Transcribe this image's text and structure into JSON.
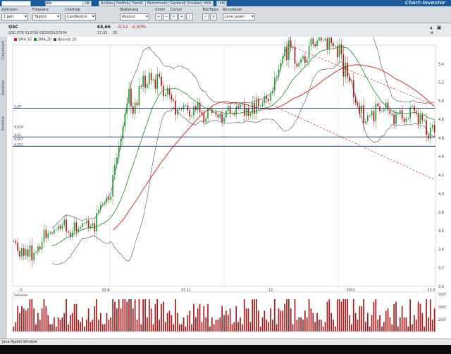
{
  "topbar": {
    "search_value": "",
    "symbol_value": "Alle",
    "search_button": "OK",
    "buttons": [
      "Auflösung",
      "Portfolio",
      "Trendf.",
      "Benchmark",
      "Gleitende",
      "Drucken",
      "Hilfe",
      "Info"
    ],
    "brand": "Chart-Investor"
  },
  "controls": {
    "groups": [
      {
        "label": "Zeitraum",
        "value": "1 Jahr"
      },
      {
        "label": "Frequenz",
        "value": "Täglich"
      },
      {
        "label": "Charttyp",
        "value": "Candlestick"
      },
      {
        "label": "Skalierung",
        "value": "Absolut"
      }
    ],
    "zoom_label": "Zoom",
    "cursor_label": "Cursor",
    "tooltips_label": "ToolTipps",
    "annotation_label": "Annotation",
    "annotation_value": "Linie Lesen"
  },
  "info": {
    "symbol": "QSC",
    "price": "€4,66",
    "change": "-0,12",
    "change_pct": "-2,50%",
    "exchange_line": "QSC ETR   513700   DE0005137004",
    "time": "17:35",
    "volume": "35"
  },
  "side_tabs": [
    "Chartbuch",
    "Kursliste",
    "Portfolio"
  ],
  "statusbar": "Java Applet Window",
  "colors": {
    "up": "#2e9e3a",
    "down": "#a81e1e",
    "sma50": "#d02020",
    "sma20": "#1c8a2a",
    "bollinger": "#505050",
    "trendline": "#c04040",
    "support": "#1a3a6a"
  },
  "chart_data": {
    "type": "candlestick",
    "legend": [
      "SMA 50",
      "SMA 20",
      "Bbands 20"
    ],
    "legend_placement": "top-left",
    "x_tick_labels": [
      "O",
      "12.8",
      "17.11",
      "12",
      "2011",
      "12.3"
    ],
    "y_tick_labels": [
      "5,4",
      "5,2",
      "5,0",
      "4,8",
      "4,6",
      "4,4",
      "4,2",
      "4,0",
      "3,8",
      "3,6",
      "3,4",
      "3,2",
      "3,0"
    ],
    "ylim": [
      3.0,
      5.6
    ],
    "left_price_labels": [
      "5,20",
      "4,929",
      "4,61",
      "4,567",
      "4,511"
    ],
    "horizontal_lines": [
      4.92,
      4.61,
      4.51
    ],
    "series": [
      {
        "name": "Close",
        "values": [
          3.49,
          3.47,
          3.38,
          3.32,
          3.41,
          3.33,
          3.4,
          3.32,
          3.44,
          3.28,
          3.36,
          3.37,
          3.43,
          3.4,
          3.48,
          3.61,
          3.52,
          3.57,
          3.58,
          3.57,
          3.61,
          3.61,
          3.65,
          3.62,
          3.66,
          3.72,
          3.59,
          3.58,
          3.53,
          3.59,
          3.69,
          3.59,
          3.62,
          3.64,
          3.68,
          3.68,
          3.71,
          3.63,
          3.65,
          3.68,
          3.59,
          3.79,
          3.82,
          3.88,
          3.89,
          3.9,
          3.96,
          3.93,
          3.97,
          4.2,
          4.31,
          4.39,
          4.51,
          4.59,
          4.72,
          4.86,
          4.97,
          5.13,
          4.94,
          4.86,
          4.98,
          4.95,
          5.16,
          5.15,
          5.27,
          5.14,
          5.18,
          5.3,
          5.22,
          5.23,
          5.13,
          5.29,
          5.26,
          5.16,
          5.05,
          5.07,
          5.13,
          5.06,
          5.01,
          5.0,
          4.85,
          4.91,
          4.92,
          4.91,
          4.95,
          4.95,
          4.9,
          4.83,
          4.84,
          4.94,
          4.9,
          4.98,
          4.88,
          4.86,
          4.77,
          4.81,
          4.91,
          4.91,
          4.87,
          4.88,
          4.85,
          4.82,
          4.86,
          4.77,
          4.82,
          4.89,
          4.94,
          4.86,
          4.87,
          4.85,
          4.94,
          4.92,
          4.96,
          4.97,
          4.84,
          4.92,
          4.84,
          4.86,
          4.98,
          4.86,
          5.01,
          4.94,
          4.94,
          4.98,
          5.05,
          5.02,
          5.0,
          5.08,
          5.11,
          5.25,
          5.26,
          5.34,
          5.41,
          5.48,
          5.58,
          5.44,
          5.65,
          5.57,
          5.58,
          5.4,
          5.37,
          5.41,
          5.45,
          5.48,
          5.41,
          5.45,
          5.59,
          5.67,
          5.61,
          5.59,
          5.65,
          5.68,
          5.65,
          5.65,
          5.67,
          5.56,
          5.68,
          5.62,
          5.59,
          5.59,
          5.47,
          5.61,
          5.5,
          5.26,
          5.41,
          5.26,
          5.21,
          5.22,
          5.04,
          4.98,
          4.95,
          4.86,
          4.95,
          4.76,
          4.78,
          4.84,
          4.84,
          4.89,
          4.78,
          4.97,
          4.94,
          4.89,
          4.89,
          4.91,
          4.98,
          4.9,
          4.86,
          4.85,
          4.75,
          4.86,
          4.86,
          4.9,
          4.81,
          4.77,
          4.81,
          4.81,
          4.93,
          4.94,
          4.89,
          4.86,
          4.75,
          4.85,
          4.79,
          4.79,
          4.63,
          4.59,
          4.71,
          4.74,
          4.66
        ]
      }
    ],
    "volume": {
      "label": "Volumen",
      "y_tick_labels": [
        "500T",
        "300T",
        "200T"
      ]
    }
  }
}
